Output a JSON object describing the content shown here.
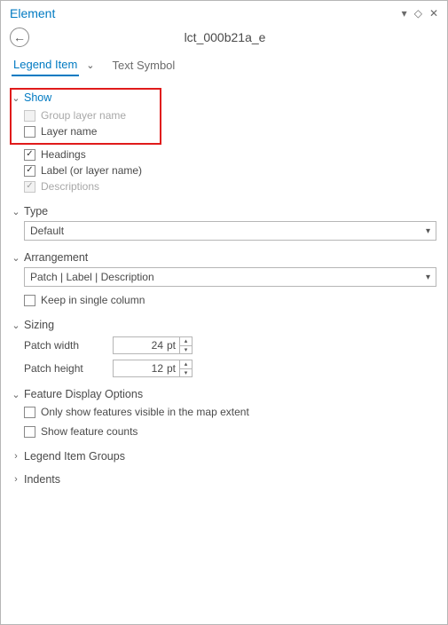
{
  "header": {
    "title": "Element"
  },
  "document_title": "lct_000b21a_e",
  "tabs": {
    "legend_item": "Legend Item",
    "text_symbol": "Text Symbol"
  },
  "sections": {
    "show": {
      "title": "Show",
      "group_layer_name": "Group layer name",
      "layer_name": "Layer name",
      "headings": "Headings",
      "label_or_layer_name": "Label (or layer name)",
      "descriptions": "Descriptions"
    },
    "type": {
      "title": "Type",
      "value": "Default"
    },
    "arrangement": {
      "title": "Arrangement",
      "value": "Patch | Label | Description",
      "keep_single_column": "Keep in single column"
    },
    "sizing": {
      "title": "Sizing",
      "patch_width_label": "Patch width",
      "patch_width_value": "24",
      "patch_height_label": "Patch height",
      "patch_height_value": "12",
      "unit": "pt"
    },
    "feature_display": {
      "title": "Feature Display Options",
      "only_visible": "Only show features visible in the map extent",
      "show_counts": "Show feature counts"
    },
    "legend_item_groups": {
      "title": "Legend Item Groups"
    },
    "indents": {
      "title": "Indents"
    }
  }
}
